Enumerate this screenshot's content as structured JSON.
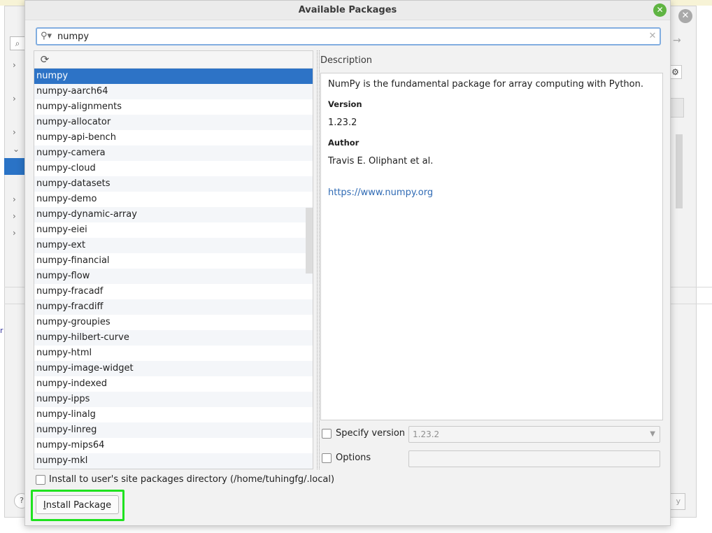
{
  "dialog": {
    "title": "Available Packages",
    "close_icon": "close-icon"
  },
  "search": {
    "value": "numpy",
    "icon": "search-icon",
    "clear_icon": "clear-icon"
  },
  "packages": {
    "refresh_icon": "refresh-icon",
    "selected": "numpy",
    "items": [
      "numpy",
      "numpy-aarch64",
      "numpy-alignments",
      "numpy-allocator",
      "numpy-api-bench",
      "numpy-camera",
      "numpy-cloud",
      "numpy-datasets",
      "numpy-demo",
      "numpy-dynamic-array",
      "numpy-eiei",
      "numpy-ext",
      "numpy-financial",
      "numpy-flow",
      "numpy-fracadf",
      "numpy-fracdiff",
      "numpy-groupies",
      "numpy-hilbert-curve",
      "numpy-html",
      "numpy-image-widget",
      "numpy-indexed",
      "numpy-ipps",
      "numpy-linalg",
      "numpy-linreg",
      "numpy-mips64",
      "numpy-mkl"
    ]
  },
  "description": {
    "label": "Description",
    "summary": "NumPy is the fundamental package for array computing with Python.",
    "version_heading": "Version",
    "version": "1.23.2",
    "author_heading": "Author",
    "author": "Travis E. Oliphant et al.",
    "url": "https://www.numpy.org"
  },
  "options": {
    "specify_version_label": "Specify version",
    "specify_version_checked": false,
    "version_value": "1.23.2",
    "options_label": "Options",
    "options_checked": false,
    "options_value": ""
  },
  "install": {
    "site_packages_label": "Install to user's site packages directory (/home/tuhingfg/.local)",
    "site_packages_checked": false,
    "button_first_letter": "I",
    "button_rest": "nstall Package"
  },
  "colors": {
    "selection": "#2d73c6",
    "highlight_box": "#1fe21f",
    "link": "#2f6ab4",
    "close_button": "#5fb442"
  }
}
